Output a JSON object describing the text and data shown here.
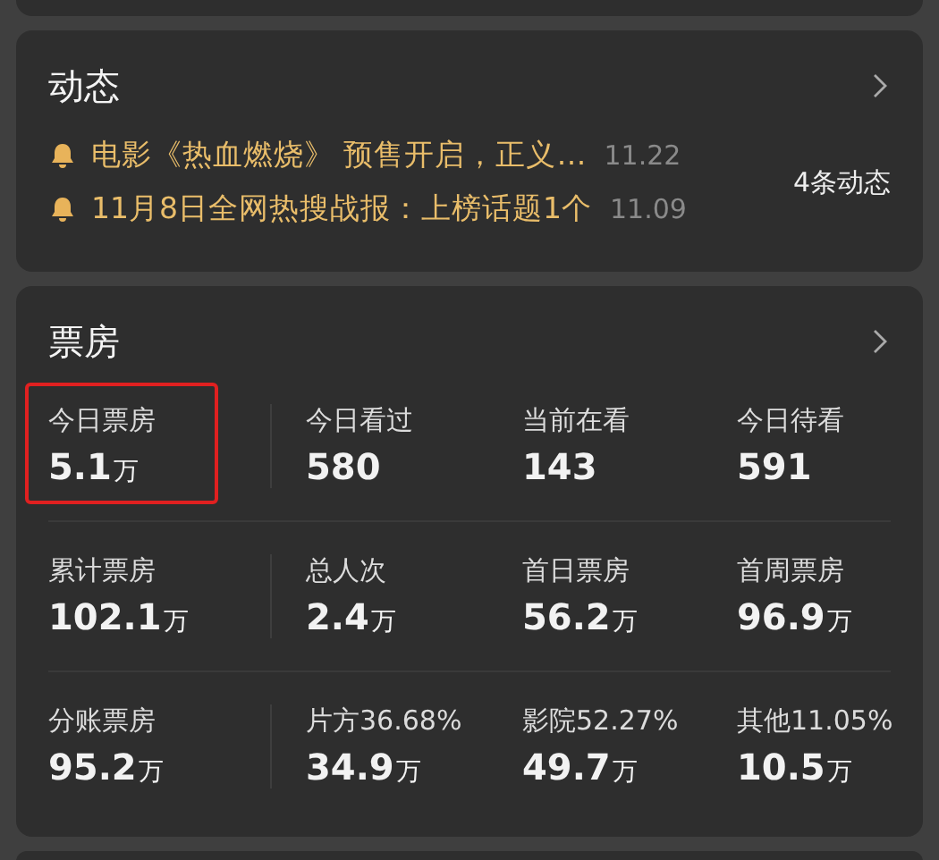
{
  "news": {
    "title": "动态",
    "count": "4条动态",
    "items": [
      {
        "text": "电影《热血燃烧》 预售开启，正义…",
        "date": "11.22"
      },
      {
        "text": "11月8日全网热搜战报：上榜话题1个",
        "date": "11.09"
      }
    ]
  },
  "box_office": {
    "title": "票房",
    "rows": [
      [
        {
          "label": "今日票房",
          "value": "5.1",
          "unit": "万",
          "highlighted": true
        },
        {
          "label": "今日看过",
          "value": "580",
          "highlighted": false
        },
        {
          "label": "当前在看",
          "value": "143",
          "highlighted": false
        },
        {
          "label": "今日待看",
          "value": "591",
          "highlighted": false
        }
      ],
      [
        {
          "label": "累计票房",
          "value": "102.1",
          "unit": "万",
          "highlighted": false
        },
        {
          "label": "总人次",
          "value": "2.4",
          "unit": "万",
          "highlighted": false
        },
        {
          "label": "首日票房",
          "value": "56.2",
          "unit": "万",
          "highlighted": false
        },
        {
          "label": "首周票房",
          "value": "96.9",
          "unit": "万",
          "highlighted": false
        }
      ],
      [
        {
          "label": "分账票房",
          "value": "95.2",
          "unit": "万",
          "highlighted": false
        },
        {
          "label": "片方36.68%",
          "value": "34.9",
          "unit": "万",
          "highlighted": false
        },
        {
          "label": "影院52.27%",
          "value": "49.7",
          "unit": "万",
          "highlighted": false
        },
        {
          "label": "其他11.05%",
          "value": "10.5",
          "unit": "万",
          "highlighted": false
        }
      ]
    ]
  }
}
